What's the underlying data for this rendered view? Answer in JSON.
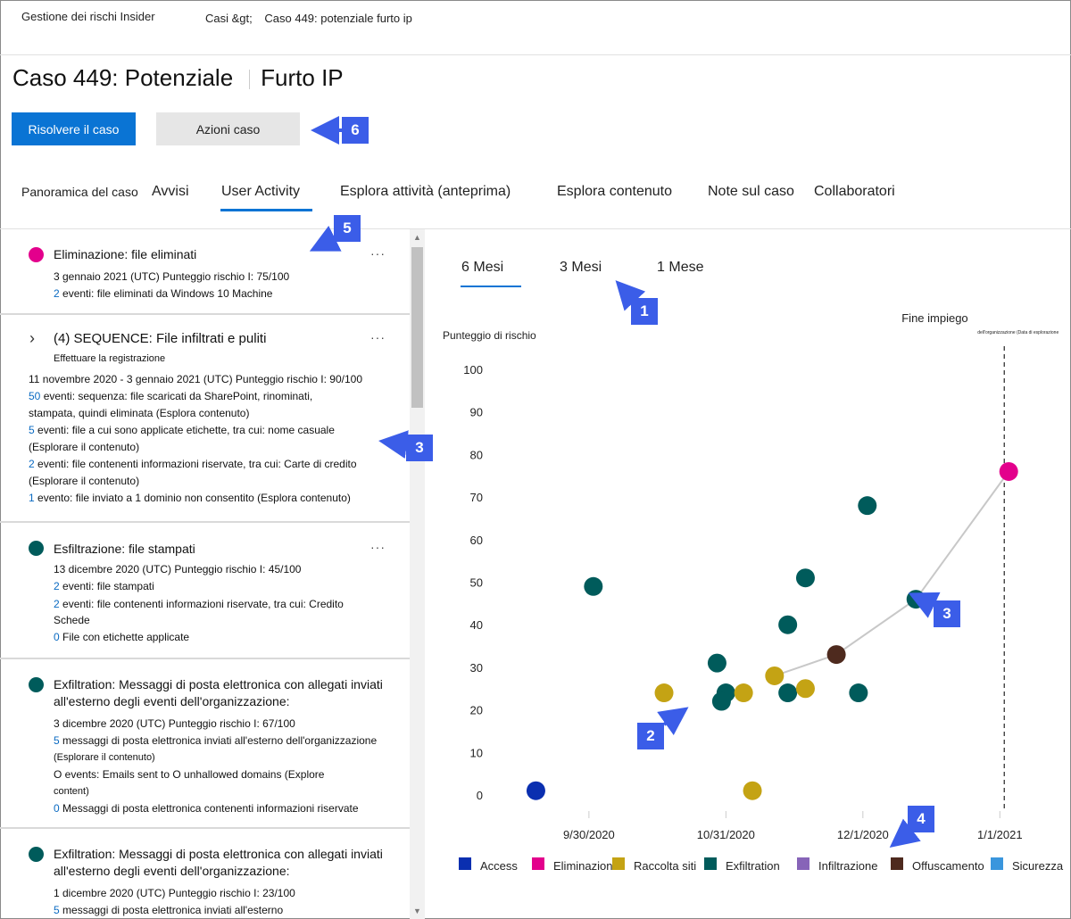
{
  "header": {
    "app_name": "Gestione dei rischi Insider",
    "breadcrumb": [
      "Casi &gt;",
      "Caso 449: potenziale furto ip"
    ]
  },
  "title": {
    "part1": "Caso 449: Potenziale",
    "part2": "Furto IP"
  },
  "actions": {
    "resolve": "Risolvere il caso",
    "case_actions": "Azioni caso"
  },
  "tabs": [
    "Panoramica del caso",
    "Avvisi",
    "User Activity",
    "Esplora attività (anteprima)",
    "Esplora contenuto",
    "Note sul caso",
    "Collaboratori"
  ],
  "active_tab": "User Activity",
  "activities": [
    {
      "color": "#e3008c",
      "title": "Eliminazione: file eliminati",
      "lines": [
        {
          "text": "3 gennaio 2021 (UTC) Punteggio rischio I: 75/100"
        },
        {
          "num": "2",
          "text": " eventi: file eliminati da Windows 10 Machine"
        }
      ]
    },
    {
      "title": "(4) SEQUENCE: File infiltrati e puliti",
      "subtitle": "Effettuare la registrazione",
      "lines": [
        {
          "text": "11 novembre 2020 - 3 gennaio 2021 (UTC) Punteggio rischio I: 90/100"
        },
        {
          "num": "50",
          "text": " eventi: sequenza: file scaricati da SharePoint, rinominati,"
        },
        {
          "text": "stampata, quindi eliminata (Esplora contenuto)"
        },
        {
          "num": "5",
          "text": " eventi: file a cui sono applicate etichette, tra cui: nome casuale"
        },
        {
          "text": "(Esplorare il contenuto)"
        },
        {
          "num": "2",
          "text": " eventi: file contenenti informazioni riservate, tra cui: Carte di credito"
        },
        {
          "text": "(Esplorare il contenuto)"
        },
        {
          "num": "1",
          "text": " evento: file inviato a 1 dominio non consentito (Esplora contenuto)"
        }
      ]
    },
    {
      "color": "#005b5b",
      "title": "Esfiltrazione: file stampati",
      "lines": [
        {
          "text": "13 dicembre 2020 (UTC) Punteggio rischio I: 45/100"
        },
        {
          "num": "2",
          "text": " eventi: file stampati"
        },
        {
          "num": "2",
          "text": " eventi: file contenenti informazioni riservate, tra cui: Credito"
        },
        {
          "text": "Schede"
        },
        {
          "num": "0",
          "text": " File con etichette applicate"
        }
      ]
    },
    {
      "color": "#005b5b",
      "title": "Exfiltration: Messaggi di posta elettronica con allegati inviati all'esterno degli eventi dell'organizzazione:",
      "lines": [
        {
          "text": "3 dicembre 2020 (UTC) Punteggio rischio I: 67/100"
        },
        {
          "num": "5",
          "text": " messaggi di posta elettronica inviati all'esterno dell'organizzazione"
        },
        {
          "text": "(Esplorare il contenuto)"
        },
        {
          "text": "O events: Emails sent to O unhallowed domains (Explore"
        },
        {
          "text": "content)"
        },
        {
          "num": "0",
          "text": " Messaggi di posta elettronica contenenti informazioni riservate"
        }
      ]
    },
    {
      "color": "#005b5b",
      "title": "Exfiltration: Messaggi di posta elettronica con allegati inviati all'esterno degli eventi dell'organizzazione:",
      "lines": [
        {
          "text": "1 dicembre 2020 (UTC) Punteggio rischio I: 23/100"
        },
        {
          "num": "5",
          "text": " messaggi di posta elettronica inviati all'esterno"
        }
      ]
    }
  ],
  "time_ranges": [
    {
      "num": "6",
      "unit": "Mesi"
    },
    {
      "num": "3",
      "unit": "Mesi"
    },
    {
      "num": "1",
      "unit": "Mese"
    }
  ],
  "active_range": "6 Mesi",
  "callouts": [
    "1",
    "2",
    "3",
    "3",
    "4",
    "5",
    "6"
  ],
  "chart_data": {
    "type": "scatter",
    "ylabel": "Punteggio di rischio",
    "ylim": [
      0,
      100
    ],
    "yticks": [
      0,
      10,
      20,
      30,
      40,
      50,
      60,
      70,
      80,
      90,
      100
    ],
    "xticks": [
      "9/30/2020",
      "10/31/2020",
      "12/1/2020",
      "1/1/2021"
    ],
    "x_range": [
      "2020-09-07",
      "2021-01-07"
    ],
    "end_marker": {
      "date": "2021-01-02",
      "label": "Fine impiego",
      "sublabel": "dell'organizzazione (Data di esplorazione"
    },
    "legend": [
      {
        "name": "Access",
        "color": "#0a2fb0"
      },
      {
        "name": "Eliminazione",
        "color": "#e3008c"
      },
      {
        "name": "Raccolta siti",
        "color": "#c4a314"
      },
      {
        "name": "Exfiltration",
        "color": "#005b5b"
      },
      {
        "name": "Infiltrazione",
        "color": "#8764b8"
      },
      {
        "name": "Offuscamento",
        "color": "#4e2a1e"
      },
      {
        "name": "Sicurezza",
        "color": "#3a96dd"
      }
    ],
    "points": [
      {
        "date": "2020-09-18",
        "y": 1,
        "category": "Access"
      },
      {
        "date": "2020-10-01",
        "y": 49,
        "category": "Exfiltration"
      },
      {
        "date": "2020-10-17",
        "y": 24,
        "category": "Raccolta siti"
      },
      {
        "date": "2020-10-29",
        "y": 31,
        "category": "Exfiltration"
      },
      {
        "date": "2020-10-31",
        "y": 24,
        "category": "Exfiltration"
      },
      {
        "date": "2020-10-30",
        "y": 22,
        "category": "Exfiltration"
      },
      {
        "date": "2020-11-04",
        "y": 24,
        "category": "Raccolta siti"
      },
      {
        "date": "2020-11-06",
        "y": 1,
        "category": "Raccolta siti"
      },
      {
        "date": "2020-11-11",
        "y": 28,
        "category": "Raccolta siti"
      },
      {
        "date": "2020-11-14",
        "y": 24,
        "category": "Exfiltration"
      },
      {
        "date": "2020-11-14",
        "y": 40,
        "category": "Exfiltration"
      },
      {
        "date": "2020-11-18",
        "y": 25,
        "category": "Raccolta siti"
      },
      {
        "date": "2020-11-18",
        "y": 51,
        "category": "Exfiltration"
      },
      {
        "date": "2020-11-25",
        "y": 33,
        "category": "Offuscamento"
      },
      {
        "date": "2020-11-30",
        "y": 24,
        "category": "Exfiltration"
      },
      {
        "date": "2020-12-02",
        "y": 68,
        "category": "Exfiltration"
      },
      {
        "date": "2020-12-13",
        "y": 46,
        "category": "Exfiltration"
      },
      {
        "date": "2021-01-03",
        "y": 76,
        "category": "Eliminazione"
      }
    ],
    "sequence_line": [
      {
        "date": "2020-11-11",
        "y": 28
      },
      {
        "date": "2020-11-25",
        "y": 33
      },
      {
        "date": "2020-12-13",
        "y": 46
      },
      {
        "date": "2021-01-03",
        "y": 76
      }
    ]
  }
}
